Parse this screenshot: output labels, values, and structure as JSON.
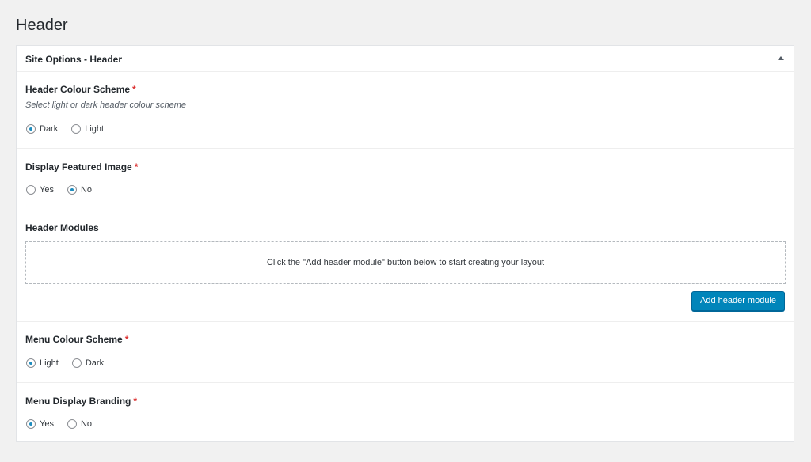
{
  "page": {
    "title": "Header"
  },
  "panel": {
    "title": "Site Options - Header",
    "toggle_icon": "triangle-up-icon"
  },
  "required_mark": "*",
  "fields": {
    "header_colour": {
      "label": "Header Colour Scheme",
      "description": "Select light or dark header colour scheme",
      "options": [
        "Dark",
        "Light"
      ],
      "selected": "Dark"
    },
    "featured_image": {
      "label": "Display Featured Image",
      "options": [
        "Yes",
        "No"
      ],
      "selected": "No"
    },
    "header_modules": {
      "label": "Header Modules",
      "empty_text": "Click the \"Add header module\" button below to start creating your layout",
      "add_button": "Add header module"
    },
    "menu_colour": {
      "label": "Menu Colour Scheme",
      "options": [
        "Light",
        "Dark"
      ],
      "selected": "Light"
    },
    "menu_branding": {
      "label": "Menu Display Branding",
      "options": [
        "Yes",
        "No"
      ],
      "selected": "Yes"
    }
  },
  "colors": {
    "accent": "#0085ba",
    "required": "#dc3232",
    "radio_dot": "#1e8cbe"
  }
}
